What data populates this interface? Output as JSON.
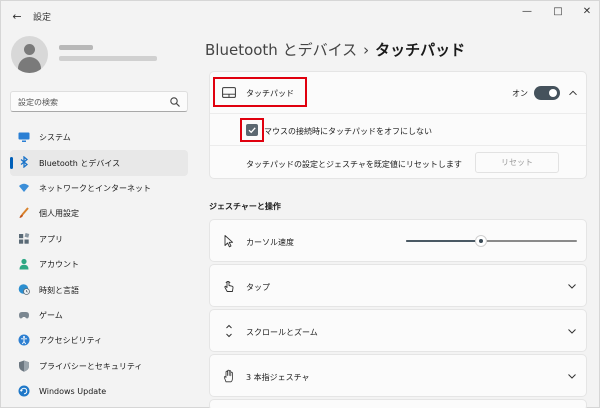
{
  "window": {
    "title": "設定"
  },
  "search": {
    "placeholder": "設定の検索"
  },
  "sidebar": {
    "items": [
      {
        "label": "システム",
        "icon": "monitor-icon",
        "color": "#2a7fd4"
      },
      {
        "label": "Bluetooth とデバイス",
        "icon": "bluetooth-icon",
        "color": "#1a73c9",
        "selected": true
      },
      {
        "label": "ネットワークとインターネット",
        "icon": "wifi-icon",
        "color": "#3b8ed8"
      },
      {
        "label": "個人用設定",
        "icon": "brush-icon",
        "color": "#d9822b"
      },
      {
        "label": "アプリ",
        "icon": "apps-icon",
        "color": "#5a6a76"
      },
      {
        "label": "アカウント",
        "icon": "person-icon",
        "color": "#2ea884"
      },
      {
        "label": "時刻と言語",
        "icon": "globe-clock-icon",
        "color": "#2c8fd0"
      },
      {
        "label": "ゲーム",
        "icon": "gamepad-icon",
        "color": "#7b8791"
      },
      {
        "label": "アクセシビリティ",
        "icon": "accessibility-icon",
        "color": "#2d7fd1"
      },
      {
        "label": "プライバシーとセキュリティ",
        "icon": "shield-icon",
        "color": "#6b7680"
      },
      {
        "label": "Windows Update",
        "icon": "update-icon",
        "color": "#1f78c8"
      }
    ]
  },
  "breadcrumb": {
    "parent": "Bluetooth とデバイス",
    "separator": "›",
    "current": "タッチパッド"
  },
  "touchpad": {
    "label": "タッチパッド",
    "toggle_state": "オン",
    "toggle_on": true,
    "leave_on_label": "マウスの接続時にタッチパッドをオフにしない",
    "leave_on_checked": true,
    "reset_text": "タッチパッドの設定とジェスチャを既定値にリセットします",
    "reset_button": "リセット"
  },
  "gestures": {
    "section_title": "ジェスチャーと操作",
    "cursor_speed": {
      "label": "カーソル速度",
      "value": 0.44
    },
    "tap": {
      "label": "タップ"
    },
    "scroll_zoom": {
      "label": "スクロールとズーム"
    },
    "three_finger": {
      "label": "3 本指ジェスチャ"
    }
  },
  "colors": {
    "accent": "#005fb8",
    "highlight": "#e0000e",
    "toggle": "#45525c"
  }
}
